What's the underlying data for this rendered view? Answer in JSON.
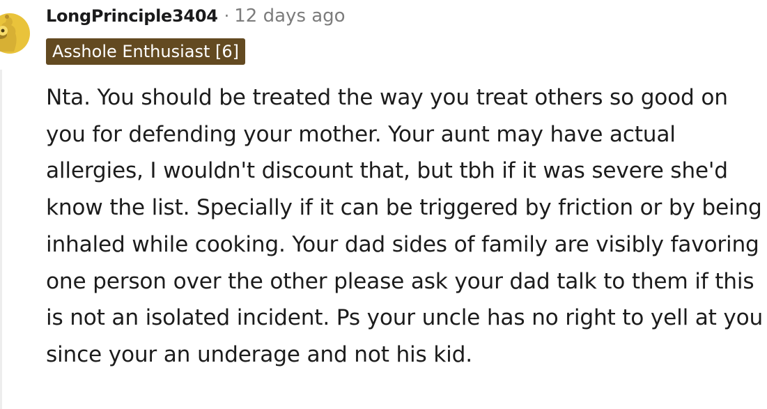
{
  "comment": {
    "author": "LongPrinciple3404",
    "separator": "·",
    "timestamp": "12 days ago",
    "flair": "Asshole Enthusiast [6]",
    "body": "Nta. You should be treated the way you treat others so good on you for defending your mother. Your aunt may have actual allergies, I wouldn't discount that, but tbh if it was severe she'd know the list. Specially if it can be triggered by friction or by being inhaled while cooking. Your dad sides of family are visibly favoring one person over the other please ask your dad talk to them if this is not an isolated incident. Ps your uncle has no right to yell at you since your an underage and not his kid.",
    "avatar_icon": "snoo-avatar-icon",
    "colors": {
      "flair_bg": "#634a21",
      "avatar": "#e9c33b",
      "meta": "#7c7c7c",
      "text": "#1c1c1c"
    }
  }
}
